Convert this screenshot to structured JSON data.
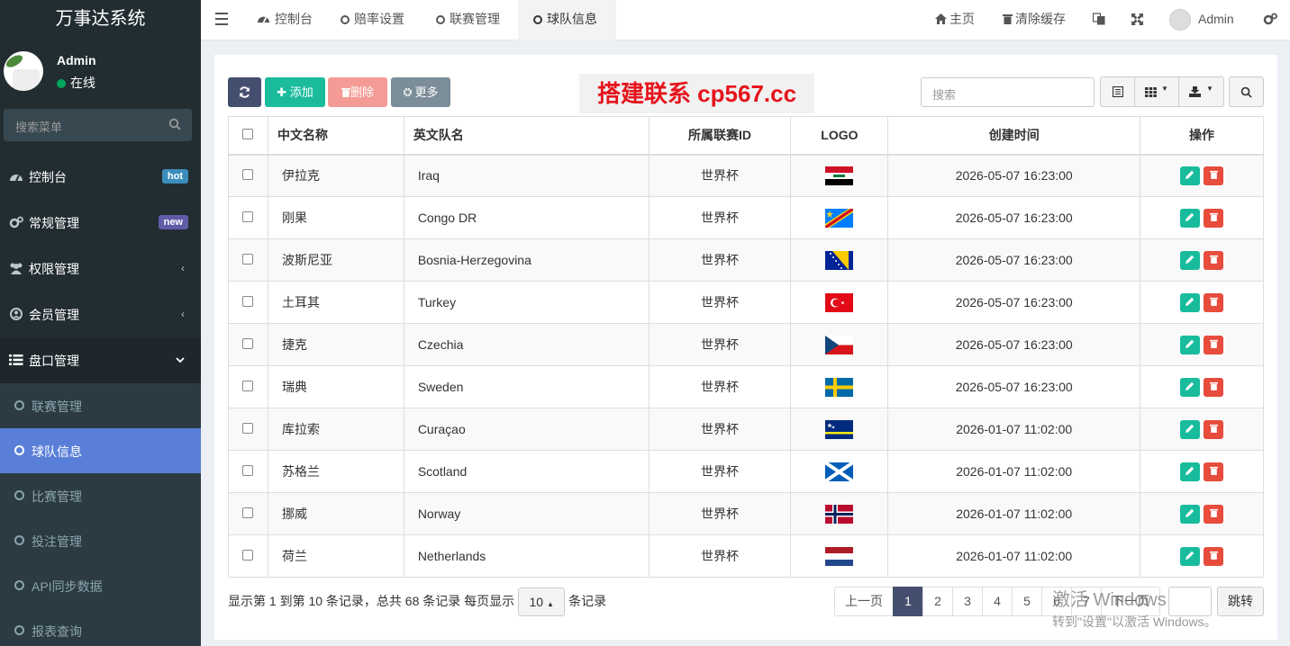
{
  "app": {
    "title": "万事达系统"
  },
  "user": {
    "name": "Admin",
    "status": "在线"
  },
  "sidebar": {
    "search_placeholder": "搜索菜单",
    "items": [
      {
        "label": "控制台",
        "badge": "hot",
        "icon": "dashboard-icon"
      },
      {
        "label": "常规管理",
        "badge": "new",
        "icon": "cogs-icon"
      },
      {
        "label": "权限管理",
        "icon": "users-icon"
      },
      {
        "label": "会员管理",
        "icon": "user-circle-icon"
      },
      {
        "label": "盘口管理",
        "icon": "list-icon"
      }
    ],
    "subitems": [
      {
        "label": "联赛管理"
      },
      {
        "label": "球队信息"
      },
      {
        "label": "比赛管理"
      },
      {
        "label": "投注管理"
      },
      {
        "label": "API同步数据"
      },
      {
        "label": "报表查询"
      }
    ]
  },
  "topnav": {
    "tabs": [
      {
        "label": "控制台"
      },
      {
        "label": "赔率设置"
      },
      {
        "label": "联赛管理"
      },
      {
        "label": "球队信息"
      }
    ],
    "home": "主页",
    "clear_cache": "清除缓存",
    "admin": "Admin"
  },
  "toolbar": {
    "add": "添加",
    "delete": "删除",
    "more": "更多",
    "search_placeholder": "搜索",
    "promo": "搭建联系 cp567.cc"
  },
  "table": {
    "headers": [
      "中文名称",
      "英文队名",
      "所属联赛ID",
      "LOGO",
      "创建时间",
      "操作"
    ],
    "rows": [
      {
        "cn": "伊拉克",
        "en": "Iraq",
        "league": "世界杯",
        "flag": "iraq",
        "time": "2026-05-07 16:23:00"
      },
      {
        "cn": "刚果",
        "en": "Congo DR",
        "league": "世界杯",
        "flag": "congo",
        "time": "2026-05-07 16:23:00"
      },
      {
        "cn": "波斯尼亚",
        "en": "Bosnia-Herzegovina",
        "league": "世界杯",
        "flag": "bosnia",
        "time": "2026-05-07 16:23:00"
      },
      {
        "cn": "土耳其",
        "en": "Turkey",
        "league": "世界杯",
        "flag": "turkey",
        "time": "2026-05-07 16:23:00"
      },
      {
        "cn": "捷克",
        "en": "Czechia",
        "league": "世界杯",
        "flag": "czech",
        "time": "2026-05-07 16:23:00"
      },
      {
        "cn": "瑞典",
        "en": "Sweden",
        "league": "世界杯",
        "flag": "sweden",
        "time": "2026-05-07 16:23:00"
      },
      {
        "cn": "库拉索",
        "en": "Curaçao",
        "league": "世界杯",
        "flag": "curacao",
        "time": "2026-01-07 11:02:00"
      },
      {
        "cn": "苏格兰",
        "en": "Scotland",
        "league": "世界杯",
        "flag": "scotland",
        "time": "2026-01-07 11:02:00"
      },
      {
        "cn": "挪威",
        "en": "Norway",
        "league": "世界杯",
        "flag": "norway",
        "time": "2026-01-07 11:02:00"
      },
      {
        "cn": "荷兰",
        "en": "Netherlands",
        "league": "世界杯",
        "flag": "netherlands",
        "time": "2026-01-07 11:02:00"
      }
    ]
  },
  "footer": {
    "info": "显示第 1 到第 10 条记录，总共 68 条记录 每页显示",
    "page_size": "10",
    "suffix": "条记录",
    "prev": "上一页",
    "pages": [
      "1",
      "2",
      "3",
      "4",
      "5",
      "6",
      "7"
    ],
    "next": "下一页",
    "jump": "跳转"
  },
  "watermark": {
    "line1": "激活 Windows",
    "line2": "转到\"设置\"以激活 Windows。"
  }
}
